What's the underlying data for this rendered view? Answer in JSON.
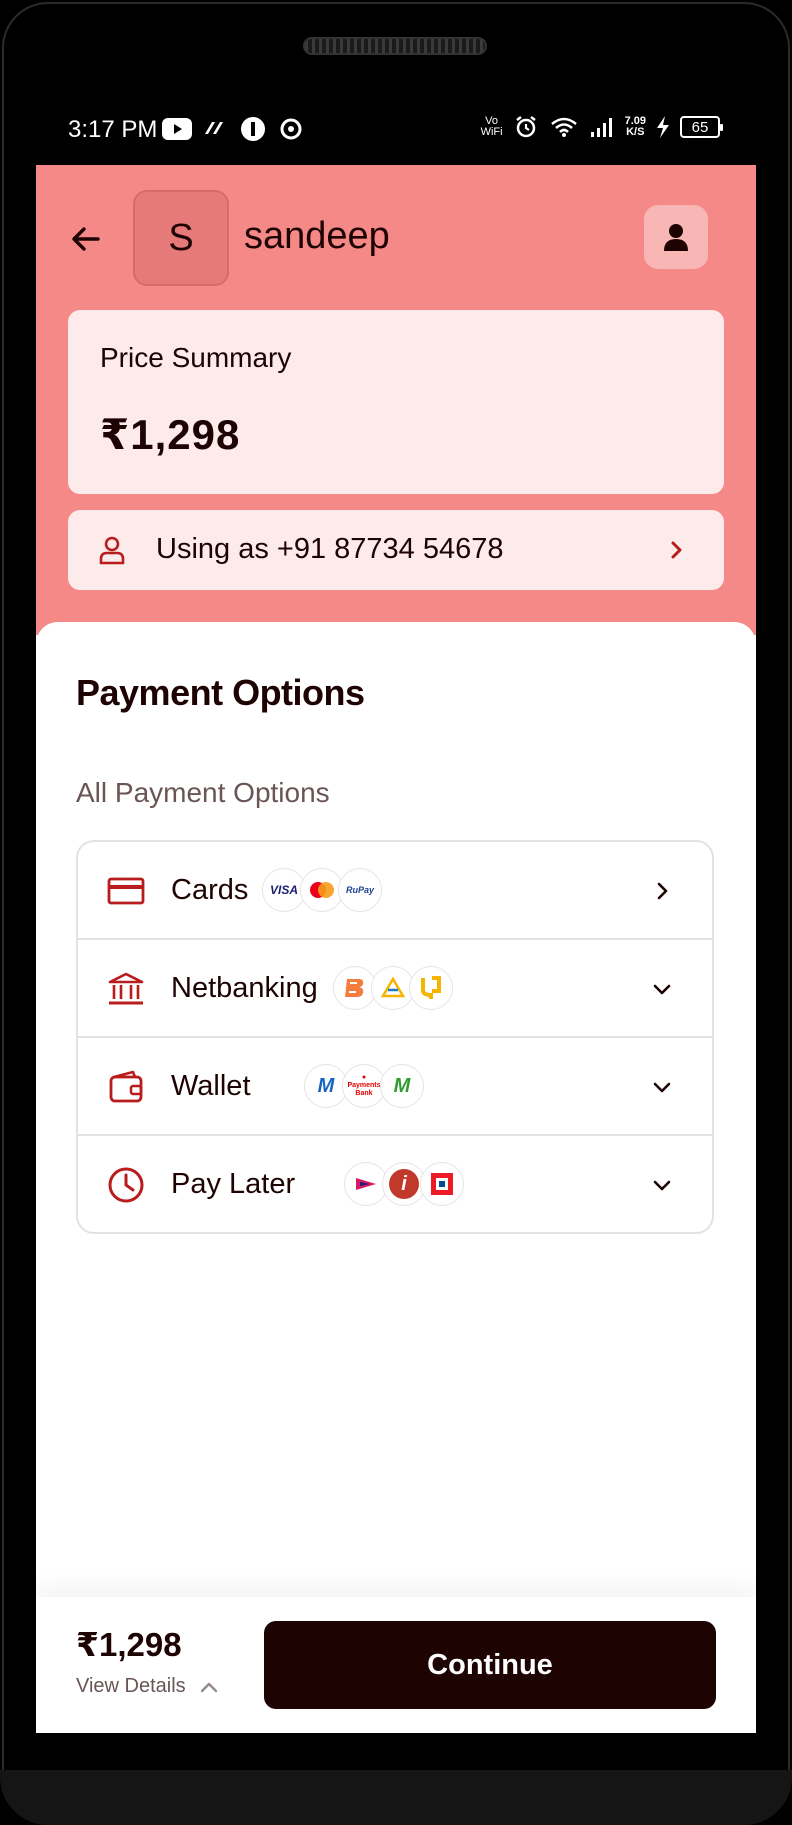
{
  "status_bar": {
    "time": "3:17 PM",
    "vowifi": "Vo\nWiFi",
    "speed": "7.09\nK/S",
    "battery": "65",
    "icons": [
      "youtube-icon",
      "app-icon",
      "app-icon",
      "app-icon",
      "alarm-icon",
      "wifi-icon",
      "signal-icon",
      "charging-icon"
    ]
  },
  "header": {
    "avatar_letter": "S",
    "user_name": "sandeep",
    "price_summary_label": "Price Summary",
    "price_value": "₹1,298",
    "using_as_text": "Using as +91 87734 54678"
  },
  "payment": {
    "title": "Payment Options",
    "subtitle": "All Payment Options",
    "options": [
      {
        "label": "Cards",
        "icon": "card-icon",
        "logos": [
          "VISA",
          "mastercard",
          "RuPay"
        ],
        "chevron": "chevron-right-icon"
      },
      {
        "label": "Netbanking",
        "icon": "bank-icon",
        "logos": [
          "bank-of-baroda",
          "sbi",
          "pnb"
        ],
        "chevron": "chevron-down-icon"
      },
      {
        "label": "Wallet",
        "icon": "wallet-icon",
        "logos": [
          "mobikwik",
          "airtel-payments-bank",
          "m-wallet"
        ],
        "chevron": "chevron-down-icon"
      },
      {
        "label": "Pay Later",
        "icon": "clock-icon",
        "logos": [
          "paylater-1",
          "icici",
          "hdfc"
        ],
        "chevron": "chevron-down-icon"
      }
    ]
  },
  "footer": {
    "price": "₹1,298",
    "view_details": "View Details",
    "continue_label": "Continue"
  },
  "colors": {
    "header_bg": "#f58987",
    "card_bg": "#fdeaea",
    "primary_dark": "#1e0303",
    "icon_red": "#b81c1c"
  }
}
